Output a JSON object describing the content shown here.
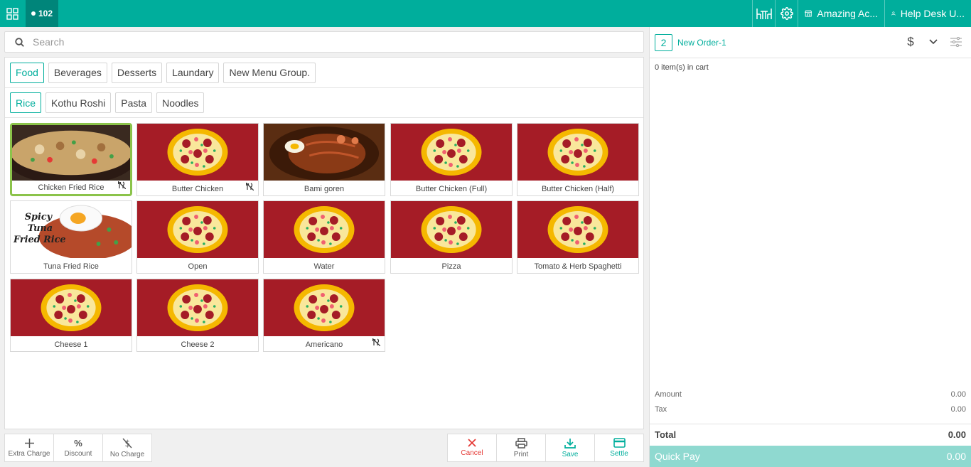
{
  "topbar": {
    "table_label": "102",
    "store_label": "Amazing Ac...",
    "user_label": "Help Desk U..."
  },
  "search": {
    "placeholder": "Search"
  },
  "menu_groups": [
    "Food",
    "Beverages",
    "Desserts",
    "Laundary",
    "New Menu Group."
  ],
  "categories": [
    "Rice",
    "Kothu Roshi",
    "Pasta",
    "Noodles"
  ],
  "items": [
    {
      "name": "Chicken Fried Rice",
      "image": "fried-rice-photo",
      "no_charge_icon": true,
      "selected": true
    },
    {
      "name": "Butter Chicken",
      "image": "pizza-placeholder",
      "no_charge_icon": true
    },
    {
      "name": "Bami goren",
      "image": "bami-goren-photo",
      "no_charge_icon": false
    },
    {
      "name": "Butter Chicken (Full)",
      "image": "pizza-placeholder",
      "no_charge_icon": false
    },
    {
      "name": "Butter Chicken (Half)",
      "image": "pizza-placeholder",
      "no_charge_icon": false
    },
    {
      "name": "Tuna Fried Rice",
      "image": "tuna-fried-rice-photo",
      "image_text": [
        "Spicy",
        "Tuna",
        "Fried Rice"
      ],
      "no_charge_icon": false
    },
    {
      "name": "Open",
      "image": "pizza-placeholder",
      "no_charge_icon": false
    },
    {
      "name": "Water",
      "image": "pizza-placeholder",
      "no_charge_icon": false
    },
    {
      "name": "Pizza",
      "image": "pizza-placeholder",
      "no_charge_icon": false
    },
    {
      "name": "Tomato & Herb Spaghetti",
      "image": "pizza-placeholder",
      "no_charge_icon": false
    },
    {
      "name": "Cheese 1",
      "image": "pizza-placeholder",
      "no_charge_icon": false
    },
    {
      "name": "Cheese 2",
      "image": "pizza-placeholder",
      "no_charge_icon": false
    },
    {
      "name": "Americano",
      "image": "pizza-placeholder",
      "no_charge_icon": true
    }
  ],
  "bottom_left": [
    {
      "label": "Extra Charge",
      "icon": "plus-icon"
    },
    {
      "label": "Discount",
      "icon": "percent-icon"
    },
    {
      "label": "No Charge",
      "icon": "no-charge-icon"
    }
  ],
  "bottom_right": [
    {
      "label": "Cancel",
      "icon": "close-icon"
    },
    {
      "label": "Print",
      "icon": "printer-icon"
    },
    {
      "label": "Save",
      "icon": "download-icon"
    },
    {
      "label": "Settle",
      "icon": "card-icon"
    }
  ],
  "order": {
    "number": "2",
    "name": "New Order-1",
    "cart_count": "0 item(s) in cart",
    "amount_label": "Amount",
    "amount_value": "0.00",
    "tax_label": "Tax",
    "tax_value": "0.00",
    "total_label": "Total",
    "total_value": "0.00",
    "quickpay_label": "Quick Pay",
    "quickpay_value": "0.00"
  },
  "colors": {
    "accent": "#00ae9c",
    "accent_dark": "#00857a",
    "pizza_bg": "#a51c26",
    "selected_border": "#8bc34a",
    "cancel_red": "#e53935",
    "quickpay_bg": "#8fd9d0"
  }
}
